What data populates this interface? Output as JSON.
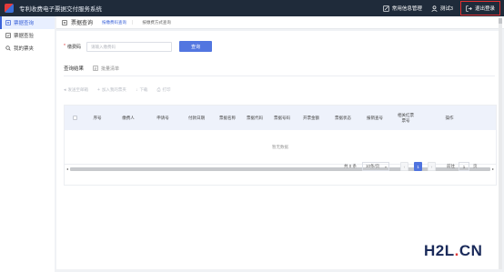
{
  "app": {
    "title": "专利收费电子票据交付服务系统",
    "top_right": {
      "manage_label": "常用信息管理",
      "user_label": "测试3",
      "logout_label": "退出登录"
    }
  },
  "sidebar": {
    "items": [
      {
        "label": "票据查询",
        "icon": "document-icon",
        "active": true
      },
      {
        "label": "票据查验",
        "icon": "check-square-icon",
        "active": false
      },
      {
        "label": "我的票夹",
        "icon": "search-icon",
        "active": false
      }
    ]
  },
  "tabs": {
    "title": "票据查询",
    "link1": "按缴费码查询",
    "link2": "按缴费方式查询",
    "separator": "|"
  },
  "form": {
    "label": "缴费码",
    "required_mark": "*",
    "placeholder": "请输入缴费码",
    "query_button": "查询"
  },
  "section": {
    "title": "查询结果",
    "sub": "批量清单"
  },
  "toolbar": {
    "items": [
      {
        "icon": "send-icon",
        "glyph": "◂",
        "label": "发送至邮箱"
      },
      {
        "icon": "plus-icon",
        "glyph": "+",
        "label": "加入我的票夹"
      },
      {
        "icon": "download-icon",
        "glyph": "↓",
        "label": "下载"
      },
      {
        "icon": "print-icon",
        "glyph": "⎙",
        "label": "打印"
      }
    ]
  },
  "table": {
    "columns": [
      "序号",
      "缴费人",
      "申请号",
      "付款日期",
      "票据名称",
      "票据代码",
      "票据号码",
      "开票金额",
      "票据状态",
      "报销查号",
      "相关红票\n票号",
      "操作"
    ],
    "empty_text": "暂无数据"
  },
  "pager": {
    "total": "共 0 条",
    "page_size": "10条/页",
    "prev": "‹",
    "current": "1",
    "next": "›",
    "goto_prefix": "前往",
    "goto_value": "1",
    "goto_suffix": "页"
  },
  "watermark": {
    "h2l": "H2L",
    "dot": ".",
    "cn": "CN"
  },
  "colors": {
    "topbar": "#1f2b3a",
    "accent": "#4f73df",
    "danger": "#e03030"
  }
}
